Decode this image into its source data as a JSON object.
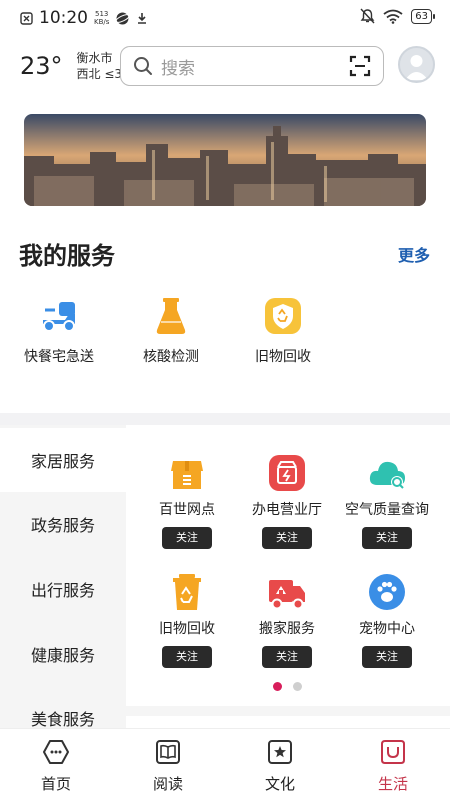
{
  "status_bar": {
    "time": "10:20",
    "net_speed_value": "513",
    "net_speed_unit": "KB/s",
    "battery": "63"
  },
  "header": {
    "temperature": "23°",
    "city": "衡水市",
    "wind": "西北 ≤3",
    "search_placeholder": "搜索"
  },
  "my_services": {
    "title": "我的服务",
    "more": "更多",
    "items": [
      {
        "label": "快餐宅急送",
        "icon": "delivery-scooter-icon"
      },
      {
        "label": "核酸检测",
        "icon": "flask-icon"
      },
      {
        "label": "旧物回收",
        "icon": "recycle-shield-icon"
      }
    ]
  },
  "categories": [
    "家居服务",
    "政务服务",
    "出行服务",
    "健康服务",
    "美食服务"
  ],
  "active_category": "家居服务",
  "grid": {
    "follow_label": "关注",
    "items": [
      {
        "label": "百世网点",
        "icon": "store-icon"
      },
      {
        "label": "办电营业厅",
        "icon": "power-hall-icon"
      },
      {
        "label": "空气质量查询",
        "icon": "cloud-search-icon"
      },
      {
        "label": "旧物回收",
        "icon": "recycle-bin-icon"
      },
      {
        "label": "搬家服务",
        "icon": "moving-truck-icon"
      },
      {
        "label": "宠物中心",
        "icon": "paw-icon"
      }
    ]
  },
  "pager": {
    "pages": 2,
    "current": 1
  },
  "tabs": [
    {
      "label": "首页",
      "icon": "home-icon"
    },
    {
      "label": "阅读",
      "icon": "book-icon"
    },
    {
      "label": "文化",
      "icon": "culture-icon"
    },
    {
      "label": "生活",
      "icon": "life-icon"
    }
  ],
  "active_tab": "生活",
  "colors": {
    "accent": "#c4344a",
    "link": "#1f5fb0",
    "follow_button": "#2a2a2a"
  }
}
